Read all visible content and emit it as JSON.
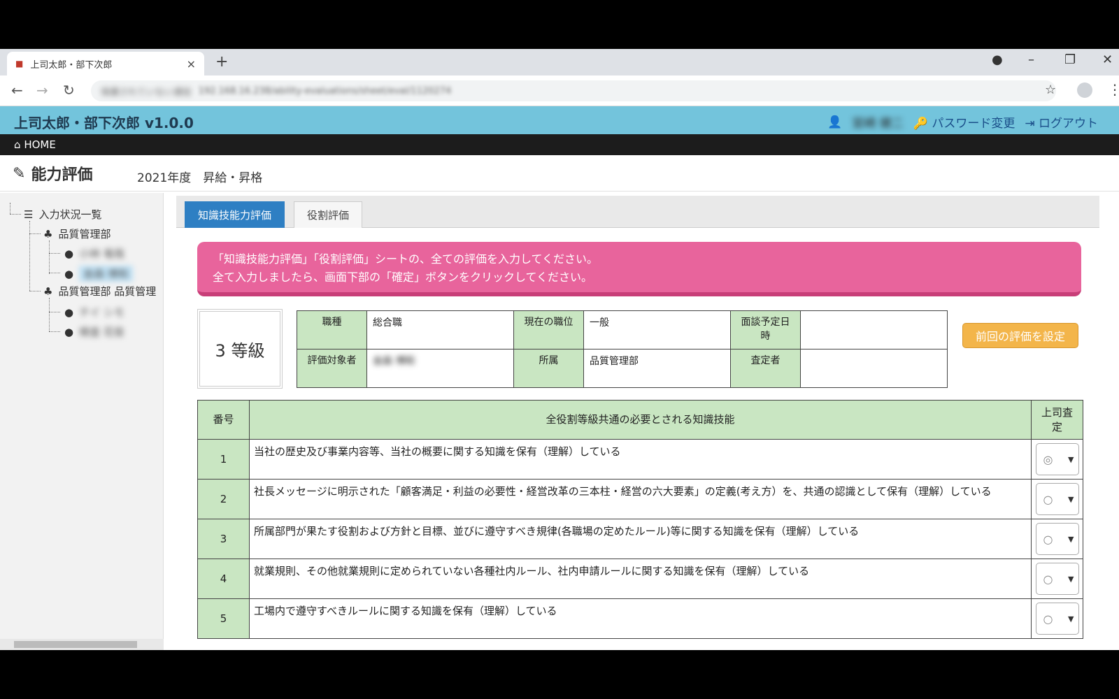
{
  "browser": {
    "tab_title": "上司太郎・部下次郎",
    "tab_close": "×",
    "new_tab": "+",
    "url_security": "保護されていない通信",
    "url": "192.168.16.238/ability-evaluations/sheet/eval/1120274"
  },
  "app": {
    "name": "上司太郎・部下次郎 v1.0.0",
    "user_name": "宮崎 健二",
    "password_change": "パスワード変更",
    "logout": "ログアウト",
    "home": "HOME"
  },
  "page": {
    "title": "能力評価",
    "subtitle": "2021年度　昇給・昇格"
  },
  "sidebar": {
    "root": "入力状況一覧",
    "groups": [
      {
        "label": "品質管理部",
        "members": [
          "小林 竜哉",
          "金森 博和"
        ]
      },
      {
        "label": "品質管理部 品質管理",
        "members": [
          "チイ シモ",
          "検査 花俊"
        ]
      }
    ]
  },
  "tabs": {
    "knowledge": "知識技能力評価",
    "role": "役割評価"
  },
  "alert": {
    "line1": "「知識技能力評価」「役割評価」シートの、全ての評価を入力してください。",
    "line2": "全て入力しましたら、画面下部の「確定」ボタンをクリックしてください。"
  },
  "grade": "3 等級",
  "info": {
    "job_type_label": "職種",
    "job_type_value": "総合職",
    "position_label": "現在の職位",
    "position_value": "一般",
    "interview_label": "面談予定日時",
    "interview_value": "",
    "target_label": "評価対象者",
    "target_value": "金森 博和",
    "dept_label": "所属",
    "dept_value": "品質管理部",
    "assessor_label": "査定者",
    "assessor_value": ""
  },
  "prev_button": "前回の評価を設定",
  "skills": {
    "col_num": "番号",
    "col_text": "全役割等級共通の必要とされる知識技能",
    "col_eval": "上司査定",
    "rows": [
      {
        "num": "1",
        "text": "当社の歴史及び事業内容等、当社の概要に関する知識を保有（理解）している",
        "value": "◎"
      },
      {
        "num": "2",
        "text": "社長メッセージに明示された「顧客満足・利益の必要性・経営改革の三本柱・経営の六大要素」の定義(考え方）を、共通の認識として保有（理解）している",
        "value": "○"
      },
      {
        "num": "3",
        "text": "所属部門が果たす役割および方針と目標、並びに遵守すべき規律(各職場の定めたルール)等に関する知識を保有（理解）している",
        "value": "○"
      },
      {
        "num": "4",
        "text": "就業規則、その他就業規則に定められていない各種社内ルール、社内申請ルールに関する知識を保有（理解）している",
        "value": "○"
      },
      {
        "num": "5",
        "text": "工場内で遵守すべきルールに関する知識を保有（理解）している",
        "value": "○"
      }
    ]
  }
}
